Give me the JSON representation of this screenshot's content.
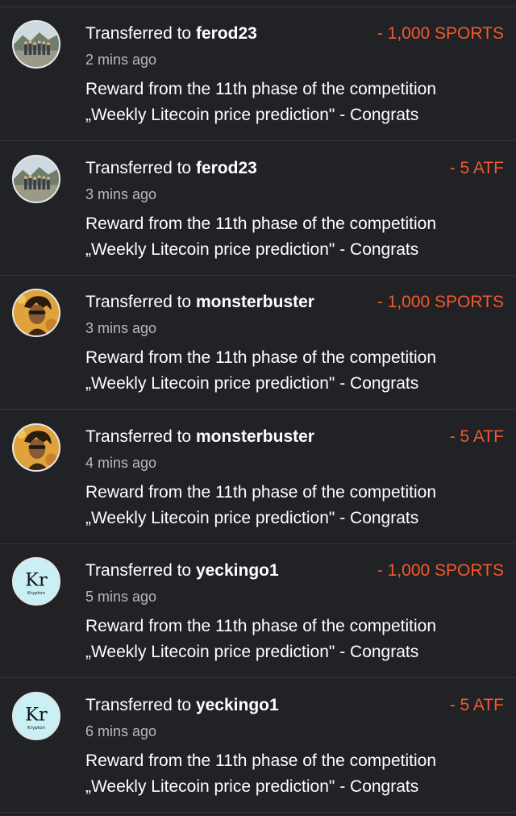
{
  "colors": {
    "background": "#212226",
    "divider": "#34363b",
    "amount": "#f2592b",
    "timestamp": "#b8b8bc",
    "text": "#ffffff"
  },
  "transactions": [
    {
      "prefix": "Transferred to",
      "user": "ferod23",
      "amount": "- 1,000 SPORTS",
      "time": "2 mins ago",
      "memo_line1": "Reward from the 11th phase of the competition",
      "memo_line2": "„Weekly Litecoin price prediction\" - Congrats",
      "avatar": "group-photo"
    },
    {
      "prefix": "Transferred to",
      "user": "ferod23",
      "amount": "- 5 ATF",
      "time": "3 mins ago",
      "memo_line1": "Reward from the 11th phase of the competition",
      "memo_line2": "„Weekly Litecoin price prediction\" - Congrats",
      "avatar": "group-photo"
    },
    {
      "prefix": "Transferred to",
      "user": "monsterbuster",
      "amount": "- 1,000 SPORTS",
      "time": "3 mins ago",
      "memo_line1": "Reward from the 11th phase of the competition",
      "memo_line2": "„Weekly Litecoin price prediction\" - Congrats",
      "avatar": "portrait-art"
    },
    {
      "prefix": "Transferred to",
      "user": "monsterbuster",
      "amount": "- 5 ATF",
      "time": "4 mins ago",
      "memo_line1": "Reward from the 11th phase of the competition",
      "memo_line2": "„Weekly Litecoin price prediction\" - Congrats",
      "avatar": "portrait-art"
    },
    {
      "prefix": "Transferred to",
      "user": "yeckingo1",
      "amount": "- 1,000 SPORTS",
      "time": "5 mins ago",
      "memo_line1": "Reward from the 11th phase of the competition",
      "memo_line2": "„Weekly Litecoin price prediction\" - Congrats",
      "avatar": "krypton-element",
      "avatar_text": "Kr",
      "avatar_subtext": "Krypton"
    },
    {
      "prefix": "Transferred to",
      "user": "yeckingo1",
      "amount": "- 5 ATF",
      "time": "6 mins ago",
      "memo_line1": "Reward from the 11th phase of the competition",
      "memo_line2": "„Weekly Litecoin price prediction\" - Congrats",
      "avatar": "krypton-element",
      "avatar_text": "Kr",
      "avatar_subtext": "Krypton"
    }
  ]
}
